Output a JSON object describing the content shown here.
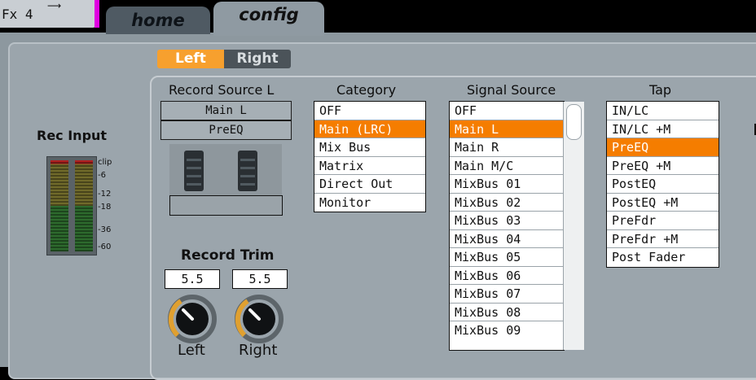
{
  "header": {
    "fx_tab_label": "Fx 4",
    "fx_tab_glyph": "⟶",
    "tabs": [
      {
        "label": "home",
        "active": false
      },
      {
        "label": "config",
        "active": true
      }
    ]
  },
  "channel_toggle": {
    "left": "Left",
    "right": "Right",
    "selected": "Left"
  },
  "record_source": {
    "title": "Record Source L",
    "source": "Main L",
    "tap": "PreEQ",
    "name": ""
  },
  "rec_input": {
    "title": "Rec Input",
    "marks": [
      "clip",
      "-6",
      "-12",
      "-18",
      "-36",
      "-60"
    ]
  },
  "record_trim": {
    "title": "Record Trim",
    "left_value": "5.5",
    "right_value": "5.5",
    "left_label": "Left",
    "right_label": "Right"
  },
  "category": {
    "title": "Category",
    "items": [
      "OFF",
      "Main (LRC)",
      "Mix Bus",
      "Matrix",
      "Direct Out",
      "Monitor"
    ],
    "selected_index": 1
  },
  "signal_source": {
    "title": "Signal Source",
    "items": [
      "OFF",
      "Main L",
      "Main R",
      "Main M/C",
      "MixBus 01",
      "MixBus 02",
      "MixBus 03",
      "MixBus 04",
      "MixBus 05",
      "MixBus 06",
      "MixBus 07",
      "MixBus 08",
      "MixBus 09"
    ],
    "selected_index": 1
  },
  "tap": {
    "title": "Tap",
    "items": [
      "IN/LC",
      "IN/LC +M",
      "PreEQ",
      "PreEQ +M",
      "PostEQ",
      "PostEQ +M",
      "PreFdr",
      "PreFdr +M",
      "Post Fader"
    ],
    "selected_index": 2
  },
  "colors": {
    "accent_orange": "#f57d00",
    "toggle_orange": "#f7a02e",
    "panel_gray": "#9ba5ac",
    "tab_magenta": "#e000e0"
  }
}
